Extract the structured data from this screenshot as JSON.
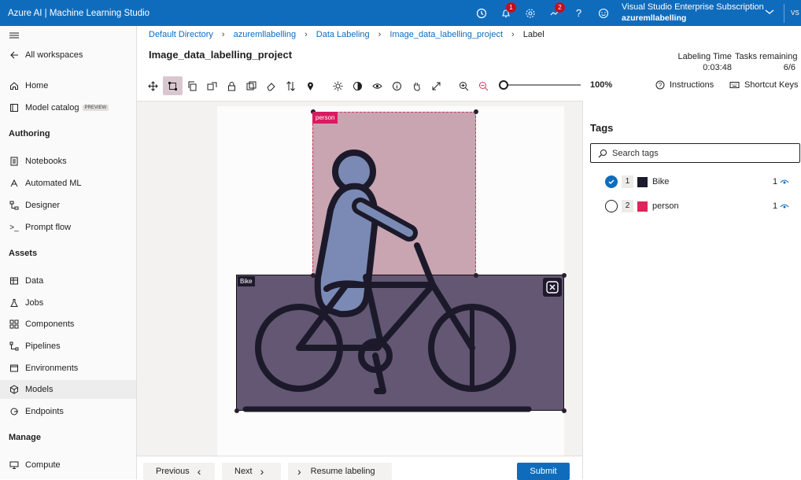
{
  "app": {
    "title": "Azure AI | Machine Learning Studio"
  },
  "header": {
    "notification_badge": "1",
    "feedback_badge": "2",
    "subscription": "Visual Studio Enterprise Subscription",
    "workspace": "azuremllabelling",
    "avatar_initials": "VS",
    "icons": [
      "history-icon",
      "bell-icon",
      "settings-icon",
      "feedback-icon",
      "help-icon",
      "smiley-icon"
    ]
  },
  "sidebar": {
    "back_label": "All workspaces",
    "home": "Home",
    "model_catalog": "Model catalog",
    "preview_badge": "PREVIEW",
    "authoring_heading": "Authoring",
    "notebooks": "Notebooks",
    "automated_ml": "Automated ML",
    "designer": "Designer",
    "prompt_flow": "Prompt flow",
    "assets_heading": "Assets",
    "data": "Data",
    "jobs": "Jobs",
    "components": "Components",
    "pipelines": "Pipelines",
    "environments": "Environments",
    "models": "Models",
    "endpoints": "Endpoints",
    "manage_heading": "Manage",
    "compute": "Compute"
  },
  "breadcrumb": [
    "Default Directory",
    "azuremllabelling",
    "Data Labeling",
    "Image_data_labelling_project",
    "Label"
  ],
  "page": {
    "title": "Image_data_labelling_project",
    "labeling_time_label": "Labeling Time",
    "labeling_time_value": "0:03:48",
    "tasks_remaining_label": "Tasks remaining",
    "tasks_remaining_value": "6/6"
  },
  "toolbar": {
    "zoom_value": "100%",
    "zoom_level": 0,
    "instructions": "Instructions",
    "shortcut_keys": "Shortcut Keys"
  },
  "canvas": {
    "person_label": "person",
    "bike_label": "Bike"
  },
  "footer": {
    "previous": "Previous",
    "next": "Next",
    "resume": "Resume labeling",
    "submit": "Submit"
  },
  "tags": {
    "title": "Tags",
    "search_placeholder": "Search tags",
    "items": [
      {
        "index": "1",
        "name": "Bike",
        "count": "1",
        "selected": true,
        "color": "#1b1a2e"
      },
      {
        "index": "2",
        "name": "person",
        "count": "1",
        "selected": false,
        "color": "#e0245e"
      }
    ]
  },
  "colors": {
    "accent": "#0f6cbd",
    "person_box": "#c8385a",
    "bike_box": "#3c2d50"
  }
}
